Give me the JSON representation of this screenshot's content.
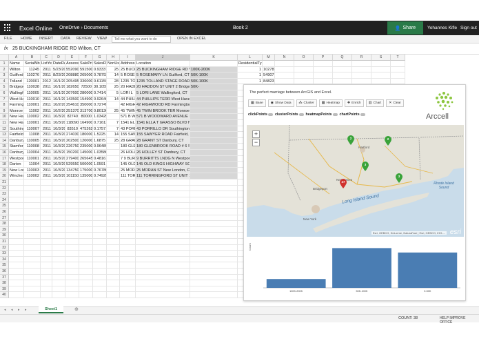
{
  "app": {
    "name": "Excel Online",
    "breadcrumb": "OneDrive › Documents",
    "doc_title": "Book 2",
    "share_label": "Share",
    "user": "Yohannes Kifle",
    "sign_out": "Sign out"
  },
  "ribbon": {
    "tabs": [
      "FILE",
      "HOME",
      "INSERT",
      "DATA",
      "REVIEW",
      "VIEW"
    ],
    "tell_me_placeholder": "Tell me what you want to do",
    "open_in_excel": "OPEN IN EXCEL"
  },
  "formula_bar": {
    "fx": "fx",
    "value": "25 BUCKINGHAM RIDGE RD Wilton, CT"
  },
  "columns": [
    "A",
    "B",
    "C",
    "D",
    "E",
    "F",
    "G",
    "H",
    "I",
    "J",
    "K",
    "L",
    "M",
    "N",
    "O",
    "P",
    "Q",
    "R",
    "S",
    "T"
  ],
  "header_row": [
    "Name",
    "SerialNbr",
    "ListYear",
    "DateReco",
    "Assessed",
    "SalePrice",
    "SalesRati",
    "NonUseC",
    "Address",
    "Location",
    "",
    "ResidentialType",
    "",
    "",
    "",
    "",
    "",
    "",
    "",
    ""
  ],
  "rows": [
    [
      "Wilton",
      "11245",
      "2011",
      "5/23/201",
      "552090",
      "591500",
      "0.93337",
      "25",
      "25 BUCK",
      "25 BUCKINGHAM RIDGE RD Wilton,",
      "100K-200K",
      "1",
      "102783"
    ],
    [
      "Guilford",
      "110276",
      "2011",
      "8/23/201",
      "208880",
      "265000",
      "0.78792",
      "14",
      "5 ROSEM",
      "5 ROSEMARY LN Guilford, CT",
      "50K-100K",
      "1",
      "54907"
    ],
    [
      "Tolland",
      "120001",
      "2012",
      "10/1/201",
      "205495",
      "336000",
      "0.61159",
      "28",
      "1235 TO",
      "1235 TOLLAND STAGE ROAD Tolla",
      "50K-100K",
      "1",
      "84823"
    ],
    [
      "Bridgepo",
      "110038",
      "2011",
      "10/1/201",
      "182650",
      "72500",
      "30.1055",
      "25",
      "20 HADD",
      "20 HADDON ST UNIT 2 Bridgeport, 0",
      "50K-",
      "1",
      ""
    ],
    [
      "Wallingfo",
      "110005",
      "2011",
      "10/1/201",
      "207600",
      "280000",
      "0.74142",
      "5",
      "LORI L",
      "5 LORI LANE Wallingford, CT",
      "",
      "",
      ""
    ],
    [
      "West Har",
      "110010",
      "2011",
      "10/1/201",
      "143500",
      "154900",
      "0.92640",
      "14",
      "44 PHILL",
      "44 PHILLIPS TERR West Haven, CT",
      "",
      "",
      ""
    ],
    [
      "Farmingt",
      "110001",
      "2011",
      "10/2/201",
      "254610",
      "350000",
      "0.72745",
      "",
      "42 HIGH",
      "42 HIGHWOOD RD Farmington, CT",
      "",
      "",
      ""
    ],
    [
      "Monroe",
      "11002",
      "2011",
      "10/2/201",
      "251370",
      "313700",
      "0.80130",
      "25",
      "45 TWIN",
      "45 TWIN BROOK TER Monroe, CT",
      "",
      "",
      ""
    ],
    [
      "New Hav",
      "110002",
      "2011",
      "10/3/201",
      "82740",
      "80000",
      "1.03425",
      "",
      "571 B W",
      "571 B WOODWARD AVENUE New H",
      "",
      "",
      ""
    ],
    [
      "New Hav",
      "110001",
      "2011",
      "10/3/201",
      "118090",
      "164900",
      "0.71613",
      "7",
      "1541 EL",
      "1541 ELLA T GRASSO BLVD New H",
      "",
      "",
      ""
    ],
    [
      "Southing",
      "110007",
      "2011",
      "10/3/201",
      "83510",
      "475262",
      "0.17571",
      "7",
      "43 PORR",
      "43 PORRILLO DR Southington, CT",
      "",
      "",
      ""
    ],
    [
      "Fairfield",
      "11008",
      "2011",
      "10/3/201",
      "274030",
      "180000",
      "1.5225",
      "14",
      "155 SAW",
      "155 SAWYER ROAD Fairfield, CT",
      "",
      "",
      ""
    ],
    [
      "Danbury",
      "110005",
      "2011",
      "10/3/201",
      "202500",
      "120000",
      "1.6875",
      "25",
      "28 GRAN",
      "28 GRANT ST Danbury, CT",
      "",
      "",
      ""
    ],
    [
      "Stamforc",
      "110008",
      "2011",
      "10/3/201",
      "226750",
      "235000",
      "0.96489",
      "",
      "180 GLE",
      "180 GLENBROOK ROAD # 6 Stamfc",
      "",
      "",
      ""
    ],
    [
      "Danbury",
      "110004",
      "2011",
      "10/3/201",
      "150200",
      "145000",
      "1.03586",
      "",
      "26 HOLL",
      "26 HOLLEY ST Danbury, CT",
      "",
      "",
      ""
    ],
    [
      "Westport",
      "110001",
      "2011",
      "10/3/201",
      "279400",
      "265645",
      "0.48161",
      "",
      "7 9 BURRI",
      "9 BURRITTS LNDG N Westport, CT",
      "",
      "",
      ""
    ],
    [
      "Darien",
      "11004",
      "2011",
      "10/3/201",
      "529550",
      "500000",
      "1.0591",
      "",
      "145 OLD",
      "145 OLD KINGS HIGHWAY SOUTH D",
      "",
      "",
      ""
    ],
    [
      "New Lon",
      "110003",
      "2011",
      "10/3/201",
      "134750",
      "175000",
      "0.76780",
      "",
      "25 MORA",
      "25 MORAN ST New London, CT",
      "",
      "",
      ""
    ],
    [
      "Winchest",
      "110002",
      "2011",
      "10/3/201",
      "101150",
      "135000",
      "0.74925",
      "",
      "111 TOR",
      "111 TORRINGFORD ST UNIT 18 Win",
      "",
      "",
      ""
    ]
  ],
  "name_box": "J",
  "addin": {
    "title": "The perfect marriage between ArcGIS and Excel.",
    "buttons": [
      {
        "icon": "map-icon",
        "glyph": "▦",
        "label": "Base"
      },
      {
        "icon": "eye-icon",
        "glyph": "◉",
        "label": "Show Data"
      },
      {
        "icon": "cluster-icon",
        "glyph": "⁂",
        "label": "Cluster"
      },
      {
        "icon": "heatmap-icon",
        "glyph": "▩",
        "label": "Heatmap"
      },
      {
        "icon": "enrich-icon",
        "glyph": "✚",
        "label": "Enrich"
      },
      {
        "icon": "chart-icon",
        "glyph": "▥",
        "label": "Chart"
      },
      {
        "icon": "clear-icon",
        "glyph": "✕",
        "label": "Clear"
      }
    ],
    "layers": [
      "clickPoints",
      "clusterPoints",
      "heatmapPoints",
      "chartPoints"
    ],
    "logo_text": "Arccell",
    "map": {
      "attribution": "Esri, GEBCO, DeLorme, NaturalVue | Esri, GEBCO, IHO-...",
      "esri": "esri",
      "labels": {
        "hartford": "Hartford",
        "long_island_sound": "Long Island Sound",
        "rhode_island_sound": "Rhode Island Sound",
        "new_york": "New York",
        "bridgeport": "Bridgeport",
        "new_haven": "New Haven"
      },
      "pins": [
        {
          "count": "2",
          "color": "#3aa33a"
        },
        {
          "count": "2",
          "color": "#3aa33a"
        },
        {
          "count": "3",
          "color": "#3aa33a"
        },
        {
          "count": "3",
          "color": "#3aa33a"
        },
        {
          "count": "27",
          "color": "#d0312d"
        }
      ]
    }
  },
  "chart_data": {
    "type": "bar",
    "categories": [
      "100K-200K",
      "50K-100K",
      "0-50K"
    ],
    "values": [
      2,
      9,
      8
    ],
    "ylabel": "Count",
    "ylim": [
      0,
      10
    ],
    "color": "#4a7db3"
  },
  "sheets": [
    "Sheet1"
  ],
  "status": {
    "count": "COUNT: 38",
    "help": "HELP IMPROVE OFFICE"
  }
}
